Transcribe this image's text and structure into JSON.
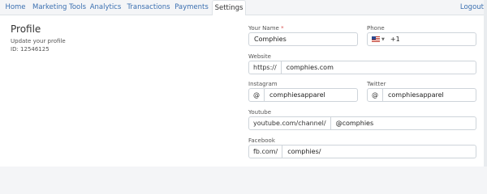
{
  "nav": {
    "tabs": [
      {
        "label": "Home"
      },
      {
        "label": "Marketing Tools"
      },
      {
        "label": "Analytics"
      },
      {
        "label": "Transactions"
      },
      {
        "label": "Payments"
      },
      {
        "label": "Settings"
      }
    ],
    "active_tab": "Settings",
    "logout_label": "Logout"
  },
  "profile": {
    "title": "Profile",
    "subtitle": "Update your profile",
    "user_id": "ID: 12546125"
  },
  "form": {
    "name": {
      "label": "Your Name",
      "required_mark": "*",
      "value": "Comphies"
    },
    "phone": {
      "label": "Phone",
      "country_code": "+1",
      "flag_icon": "us-flag-icon"
    },
    "website": {
      "label": "Website",
      "prefix": "https://",
      "value": "comphies.com"
    },
    "instagram": {
      "label": "Instagram",
      "prefix": "@",
      "value": "comphiesapparel"
    },
    "twitter": {
      "label": "Twitter",
      "prefix": "@",
      "value": "comphiesapparel"
    },
    "youtube": {
      "label": "Youtube",
      "prefix": "youtube.com/channel/",
      "value": "@comphies"
    },
    "facebook": {
      "label": "Facebook",
      "prefix": "fb.com/",
      "value": "comphies/"
    }
  },
  "colors": {
    "link": "#3a6fb0",
    "required": "#d9534f",
    "border": "#ced4da"
  }
}
